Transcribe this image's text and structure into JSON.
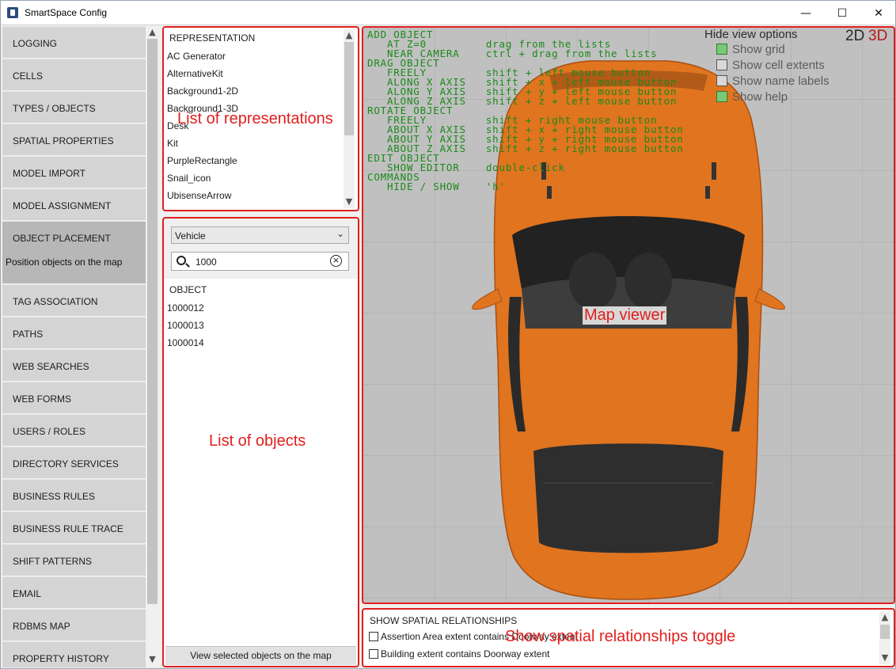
{
  "window": {
    "title": "SmartSpace Config",
    "minimize": "—",
    "maximize": "☐",
    "close": "✕"
  },
  "sidebar": {
    "items": [
      {
        "label": "LOGGING"
      },
      {
        "label": "CELLS"
      },
      {
        "label": "TYPES / OBJECTS"
      },
      {
        "label": "SPATIAL PROPERTIES"
      },
      {
        "label": "MODEL IMPORT"
      },
      {
        "label": "MODEL ASSIGNMENT"
      },
      {
        "label": "OBJECT PLACEMENT",
        "active": true,
        "subtitle": "Position objects on the map"
      },
      {
        "label": "TAG ASSOCIATION"
      },
      {
        "label": "PATHS"
      },
      {
        "label": "WEB SEARCHES"
      },
      {
        "label": "WEB FORMS"
      },
      {
        "label": "USERS / ROLES"
      },
      {
        "label": "DIRECTORY SERVICES"
      },
      {
        "label": "BUSINESS RULES"
      },
      {
        "label": "BUSINESS RULE TRACE"
      },
      {
        "label": "SHIFT PATTERNS"
      },
      {
        "label": "EMAIL"
      },
      {
        "label": "RDBMS MAP"
      },
      {
        "label": "PROPERTY HISTORY"
      }
    ],
    "scroll_up": "▲",
    "scroll_down": "▼"
  },
  "representations": {
    "header": "REPRESENTATION",
    "items": [
      "AC Generator",
      "AlternativeKit",
      "Background1-2D",
      "Background1-3D",
      "Desk",
      "Kit",
      "PurpleRectangle",
      "Snail_icon",
      "UbisenseArrow"
    ],
    "scroll_up": "▲",
    "scroll_down": "▼"
  },
  "objects": {
    "type_selected": "Vehicle",
    "search_value": "1000",
    "clear_glyph": "×",
    "header": "OBJECT",
    "items": [
      "1000012",
      "1000013",
      "1000014"
    ],
    "view_button": "View selected objects on the map"
  },
  "map": {
    "help_lines": [
      "ADD OBJECT",
      "   AT Z=0         drag from the lists",
      "   NEAR CAMERA    ctrl + drag from the lists",
      "DRAG OBJECT",
      "   FREELY         shift + left mouse button",
      "   ALONG X AXIS   shift + x + left mouse button",
      "   ALONG Y AXIS   shift + y + left mouse button",
      "   ALONG Z AXIS   shift + z + left mouse button",
      "ROTATE OBJECT",
      "   FREELY         shift + right mouse button",
      "   ABOUT X AXIS   shift + x + right mouse button",
      "   ABOUT Y AXIS   shift + y + right mouse button",
      "   ABOUT Z AXIS   shift + z + right mouse button",
      "EDIT OBJECT",
      "   SHOW EDITOR    double-click",
      "COMMANDS",
      "   HIDE / SHOW    'h'"
    ],
    "view_options_title": "Hide view options",
    "options": [
      {
        "label": "Show grid",
        "checked": true
      },
      {
        "label": "Show cell extents",
        "checked": false
      },
      {
        "label": "Show name labels",
        "checked": false
      },
      {
        "label": "Show help",
        "checked": true
      }
    ],
    "mode_2d": "2D",
    "mode_3d": "3D",
    "car_color": "#e0741f",
    "help_color": "#1a8a1a"
  },
  "spatial": {
    "header": "SHOW SPATIAL RELATIONSHIPS",
    "rows": [
      "Assertion Area extent contains Doorway extent",
      "Building extent contains Doorway extent"
    ],
    "scroll_up": "▲",
    "scroll_down": "▼"
  },
  "annotations": {
    "representations": "List of representations",
    "objects": "List of objects",
    "map": "Map viewer",
    "spatial": "Show spatial relationships toggle",
    "color": "#e0201e"
  }
}
